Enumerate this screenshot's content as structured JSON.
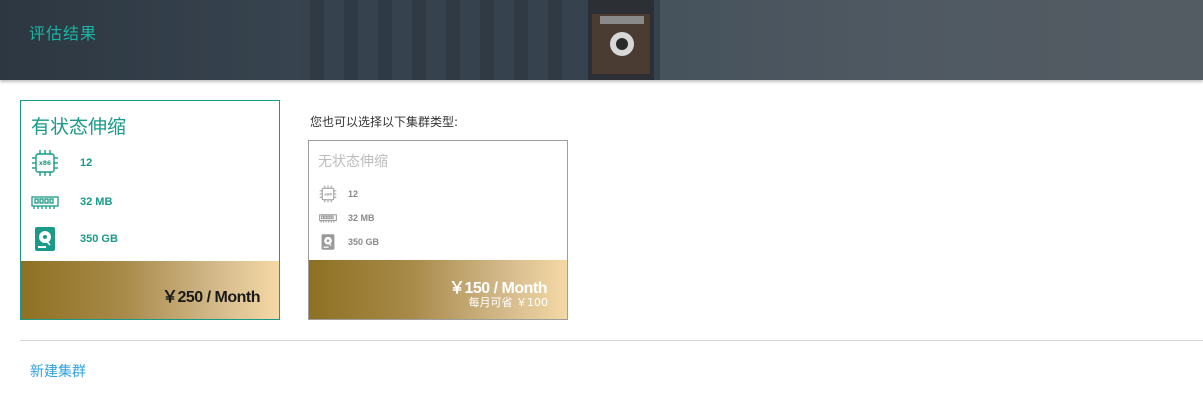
{
  "header": {
    "title": "评估结果"
  },
  "recommended": {
    "name": "有状态伸缩",
    "specs": [
      {
        "icon": "cpu-icon",
        "value": "12"
      },
      {
        "icon": "memory-icon",
        "value": "32 MB"
      },
      {
        "icon": "disk-icon",
        "value": "350 GB"
      }
    ],
    "price": "￥250 / Month"
  },
  "alternatives_label": "您也可以选择以下集群类型:",
  "alternative": {
    "name": "无状态伸缩",
    "specs": [
      {
        "icon": "cpu-icon",
        "value": "12"
      },
      {
        "icon": "memory-icon",
        "value": "32 MB"
      },
      {
        "icon": "disk-icon",
        "value": "350 GB"
      }
    ],
    "price": "￥150 / Month",
    "saving": "每月可省 ￥100"
  },
  "actions": {
    "create_cluster": "新建集群"
  },
  "colors": {
    "accent": "#1a9a88",
    "link": "#2ea2e0",
    "gold_start": "#8e7023",
    "gold_end": "#f4d9a6"
  }
}
